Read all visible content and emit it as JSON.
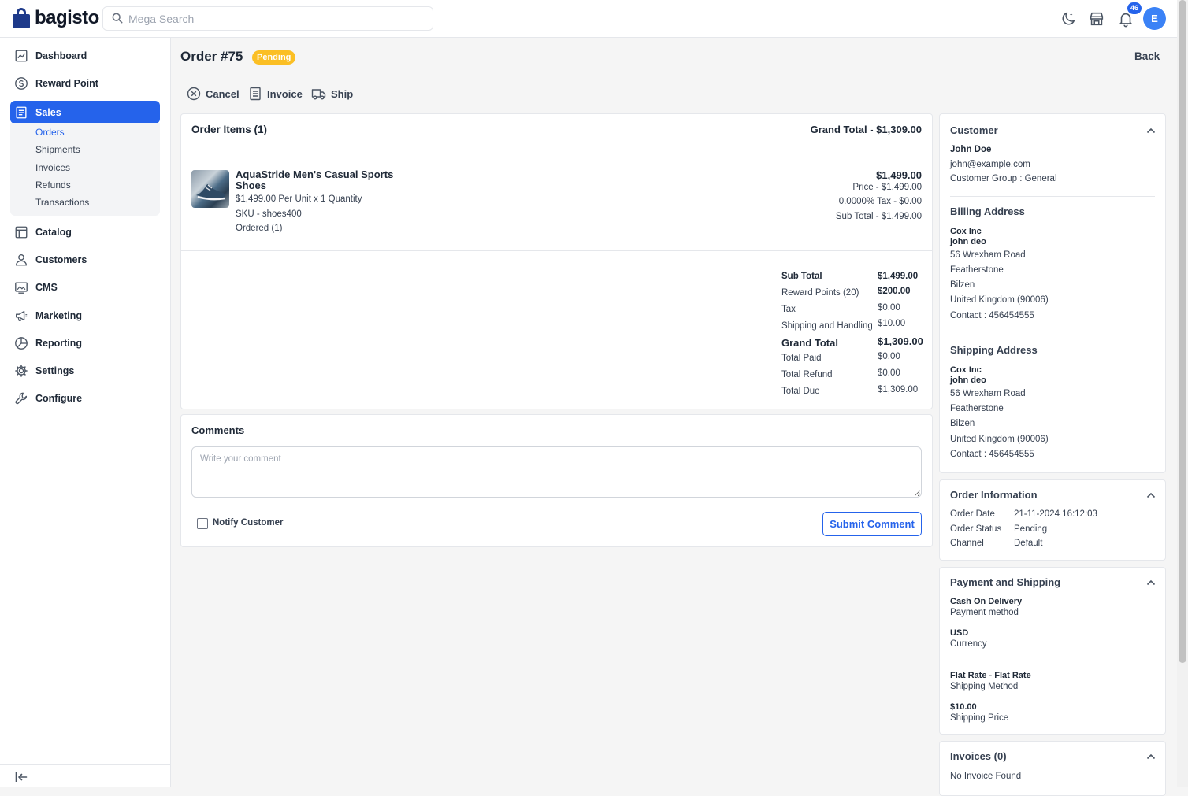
{
  "header": {
    "brand": "bagisto",
    "search_placeholder": "Mega Search",
    "notification_count": "46",
    "avatar_initial": "E"
  },
  "sidebar": {
    "items": [
      {
        "label": "Dashboard",
        "icon": "dashboard-icon"
      },
      {
        "label": "Reward Point",
        "icon": "dollar-circle-icon"
      },
      {
        "label": "Sales",
        "icon": "sales-icon"
      },
      {
        "label": "Catalog",
        "icon": "catalog-icon"
      },
      {
        "label": "Customers",
        "icon": "user-icon"
      },
      {
        "label": "CMS",
        "icon": "cms-icon"
      },
      {
        "label": "Marketing",
        "icon": "megaphone-icon"
      },
      {
        "label": "Reporting",
        "icon": "pie-chart-icon"
      },
      {
        "label": "Settings",
        "icon": "gear-icon"
      },
      {
        "label": "Configure",
        "icon": "wrench-icon"
      }
    ],
    "sales_sub": [
      "Orders",
      "Shipments",
      "Invoices",
      "Refunds",
      "Transactions"
    ]
  },
  "order": {
    "title": "Order #75",
    "status_badge": "Pending",
    "back_label": "Back",
    "actions": {
      "cancel": "Cancel",
      "invoice": "Invoice",
      "ship": "Ship"
    }
  },
  "items_card": {
    "heading": "Order Items (1)",
    "grand_total_label": "Grand Total - $1,309.00",
    "item": {
      "name_line1": "AquaStride Men's Casual Sports",
      "name_line2": "Shoes",
      "unit_line": "$1,499.00 Per Unit x 1 Quantity",
      "sku": "SKU - shoes400",
      "ordered": "Ordered (1)",
      "price_big": "$1,499.00",
      "price": "Price - $1,499.00",
      "tax": "0.0000% Tax - $0.00",
      "subtotal": "Sub Total - $1,499.00"
    }
  },
  "totals": [
    {
      "label": "Sub Total",
      "value": "$1,499.00",
      "style": "bold"
    },
    {
      "label": "Reward Points (20)",
      "value": "$200.00",
      "style": "value-bold"
    },
    {
      "label": "Tax",
      "value": "$0.00",
      "style": "normal"
    },
    {
      "label": "Shipping and Handling",
      "value": "$10.00",
      "style": "normal"
    },
    {
      "label": "Grand Total",
      "value": "$1,309.00",
      "style": "big"
    },
    {
      "label": "Total Paid",
      "value": "$0.00",
      "style": "normal"
    },
    {
      "label": "Total Refund",
      "value": "$0.00",
      "style": "normal"
    },
    {
      "label": "Total Due",
      "value": "$1,309.00",
      "style": "normal"
    }
  ],
  "comments": {
    "heading": "Comments",
    "placeholder": "Write your comment",
    "notify_label": "Notify Customer",
    "submit_label": "Submit Comment"
  },
  "customer": {
    "heading": "Customer",
    "name": "John Doe",
    "email": "john@example.com",
    "group": "Customer Group : General"
  },
  "billing": {
    "heading": "Billing Address",
    "company": "Cox Inc",
    "name": "john deo",
    "street": "56 Wrexham Road",
    "city": "Featherstone",
    "state": "Bilzen",
    "country": "United Kingdom (90006)",
    "contact": "Contact : 456454555"
  },
  "shipping": {
    "heading": "Shipping Address",
    "company": "Cox Inc",
    "name": "john deo",
    "street": "56 Wrexham Road",
    "city": "Featherstone",
    "state": "Bilzen",
    "country": "United Kingdom (90006)",
    "contact": "Contact : 456454555"
  },
  "order_info": {
    "heading": "Order Information",
    "rows": [
      {
        "label": "Order Date",
        "value": "21-11-2024 16:12:03"
      },
      {
        "label": "Order Status",
        "value": "Pending"
      },
      {
        "label": "Channel",
        "value": "Default"
      }
    ]
  },
  "payment_shipping": {
    "heading": "Payment and Shipping",
    "payment_value": "Cash On Delivery",
    "payment_label": "Payment method",
    "currency_value": "USD",
    "currency_label": "Currency",
    "shipping_value": "Flat Rate - Flat Rate",
    "shipping_label": "Shipping Method",
    "price_value": "$10.00",
    "price_label": "Shipping Price"
  },
  "invoices": {
    "heading": "Invoices (0)",
    "empty": "No Invoice Found"
  },
  "colors": {
    "accent": "#2563eb",
    "pending": "#fbbf24"
  }
}
